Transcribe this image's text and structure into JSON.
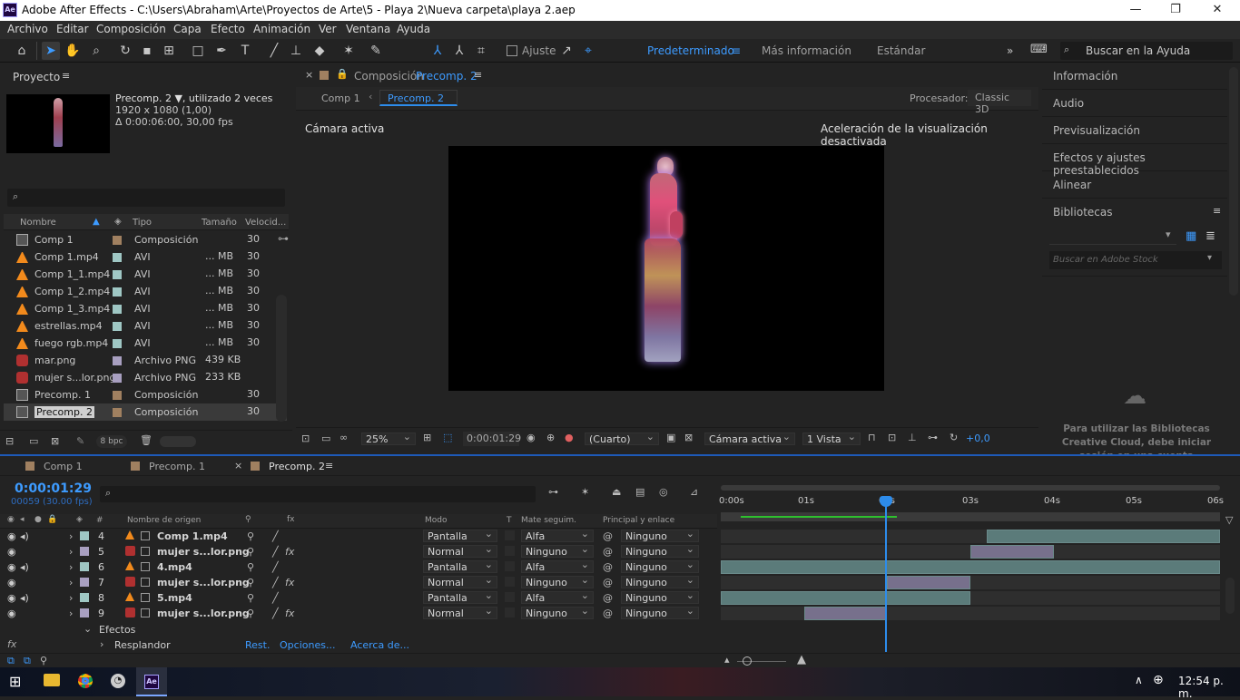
{
  "window": {
    "title": "Adobe After Effects - C:\\Users\\Abraham\\Arte\\Proyectos de Arte\\5 - Playa 2\\Nueva carpeta\\playa 2.aep",
    "app_icon": "Ae"
  },
  "menu": [
    "Archivo",
    "Editar",
    "Composición",
    "Capa",
    "Efecto",
    "Animación",
    "Ver",
    "Ventana",
    "Ayuda"
  ],
  "toolbar": {
    "snap_label": "Ajuste",
    "workspaces": [
      "Predeterminado",
      "Más información",
      "Estándar"
    ],
    "search_placeholder": "Buscar en la Ayuda"
  },
  "project": {
    "title": "Proyecto",
    "selected_name": "Precomp. 2 ▼",
    "used": ", utilizado 2 veces",
    "dims": "1920 x 1080 (1,00)",
    "duration": "Δ 0:00:06:00, 30,00 fps",
    "columns": [
      "Nombre",
      "Tipo",
      "Tamaño",
      "Velocid..."
    ],
    "items": [
      {
        "name": "Comp 1",
        "type": "Composición",
        "size": "",
        "fps": "30",
        "icon": "comp",
        "color": "#a08060"
      },
      {
        "name": "Comp 1.mp4",
        "type": "AVI",
        "size": "... MB",
        "fps": "30",
        "icon": "vlc",
        "color": "#9fc7c4"
      },
      {
        "name": "Comp 1_1.mp4",
        "type": "AVI",
        "size": "... MB",
        "fps": "30",
        "icon": "vlc",
        "color": "#9fc7c4"
      },
      {
        "name": "Comp 1_2.mp4",
        "type": "AVI",
        "size": "... MB",
        "fps": "30",
        "icon": "vlc",
        "color": "#9fc7c4"
      },
      {
        "name": "Comp 1_3.mp4",
        "type": "AVI",
        "size": "... MB",
        "fps": "30",
        "icon": "vlc",
        "color": "#9fc7c4"
      },
      {
        "name": "estrellas.mp4",
        "type": "AVI",
        "size": "... MB",
        "fps": "30",
        "icon": "vlc",
        "color": "#9fc7c4"
      },
      {
        "name": "fuego rgb.mp4",
        "type": "AVI",
        "size": "... MB",
        "fps": "30",
        "icon": "vlc",
        "color": "#9fc7c4"
      },
      {
        "name": "mar.png",
        "type": "Archivo PNG",
        "size": "439 KB",
        "fps": "",
        "icon": "png",
        "color": "#a89fc0"
      },
      {
        "name": "mujer s...lor.png",
        "type": "Archivo PNG",
        "size": "233 KB",
        "fps": "",
        "icon": "png",
        "color": "#a89fc0"
      },
      {
        "name": "Precomp. 1",
        "type": "Composición",
        "size": "",
        "fps": "30",
        "icon": "comp",
        "color": "#a08060"
      },
      {
        "name": "Precomp. 2",
        "type": "Composición",
        "size": "",
        "fps": "30",
        "icon": "comp",
        "color": "#a08060"
      }
    ],
    "bpc": "8 bpc"
  },
  "viewer": {
    "tab_prefix": "Composición",
    "tab_name": "Precomp. 2",
    "crumbs": [
      "Comp 1",
      "Precomp. 2"
    ],
    "renderer_label": "Procesador:",
    "renderer": "Classic 3D",
    "camera": "Cámara activa",
    "accel": "Aceleración de la visualización desactivada",
    "zoom": "25%",
    "time": "0:00:01:29",
    "resolution": "(Cuarto)",
    "camera_dd": "Cámara activa",
    "views": "1 Vista",
    "exposure": "+0,0"
  },
  "right": {
    "panels": [
      "Información",
      "Audio",
      "Previsualización",
      "Efectos y ajustes preestablecidos",
      "Alinear",
      "Bibliotecas"
    ],
    "stock_placeholder": "Buscar en Adobe Stock",
    "cc_msg": "Para utilizar las Bibliotecas Creative Cloud, debe iniciar sesión en una cuenta"
  },
  "timeline": {
    "tabs": [
      "Comp 1",
      "Precomp. 1",
      "Precomp. 2"
    ],
    "time": "0:00:01:29",
    "frames": "00059 (30.00 fps)",
    "cols": {
      "hash": "#",
      "source": "Nombre de origen",
      "mode": "Modo",
      "t": "T",
      "matte": "Mate seguim.",
      "parent": "Principal y enlace"
    },
    "ruler": [
      "0:00s",
      "01s",
      "02s",
      "03s",
      "04s",
      "05s",
      "06s"
    ],
    "layers": [
      {
        "num": "4",
        "name": "Comp 1.mp4",
        "mode": "Pantalla",
        "matte": "Alfa",
        "parent": "Ninguno",
        "color": "#9fc7c4",
        "audio": true,
        "fx": false,
        "icon": "vlc"
      },
      {
        "num": "5",
        "name": "mujer s...lor.png",
        "mode": "Normal",
        "matte": "Ninguno",
        "parent": "Ninguno",
        "color": "#a89fc0",
        "audio": false,
        "fx": true,
        "icon": "png"
      },
      {
        "num": "6",
        "name": "4.mp4",
        "mode": "Pantalla",
        "matte": "Alfa",
        "parent": "Ninguno",
        "color": "#9fc7c4",
        "audio": true,
        "fx": false,
        "icon": "vlc"
      },
      {
        "num": "7",
        "name": "mujer s...lor.png",
        "mode": "Normal",
        "matte": "Ninguno",
        "parent": "Ninguno",
        "color": "#a89fc0",
        "audio": false,
        "fx": true,
        "icon": "png"
      },
      {
        "num": "8",
        "name": "5.mp4",
        "mode": "Pantalla",
        "matte": "Alfa",
        "parent": "Ninguno",
        "color": "#9fc7c4",
        "audio": true,
        "fx": false,
        "icon": "vlc"
      },
      {
        "num": "9",
        "name": "mujer s...lor.png",
        "mode": "Normal",
        "matte": "Ninguno",
        "parent": "Ninguno",
        "color": "#a89fc0",
        "audio": false,
        "fx": true,
        "icon": "png"
      }
    ],
    "effects_label": "Efectos",
    "effect": {
      "name": "Resplandor",
      "reset": "Rest.",
      "options": "Opciones...",
      "about": "Acerca de..."
    }
  },
  "taskbar": {
    "clock": "12:54 p. m."
  }
}
